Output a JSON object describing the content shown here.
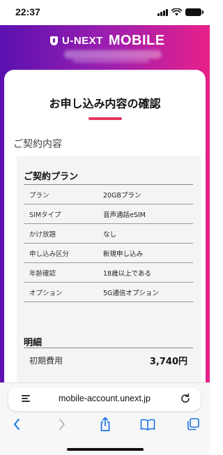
{
  "status_bar": {
    "time": "22:37"
  },
  "header": {
    "brand_name": "U-NEXT",
    "brand_product": "MOBILE"
  },
  "page": {
    "title": "お申し込み内容の確認",
    "section_title": "ご契約内容"
  },
  "plan": {
    "title": "ご契約プラン",
    "rows": [
      {
        "key": "プラン",
        "value": "20GBプラン"
      },
      {
        "key": "SIMタイプ",
        "value": "音声通話eSIM"
      },
      {
        "key": "かけ放題",
        "value": "なし"
      },
      {
        "key": "申し込み区分",
        "value": "新規申し込み"
      },
      {
        "key": "年齢確認",
        "value": "18歳以上である"
      },
      {
        "key": "オプション",
        "value": "5G通信オプション"
      }
    ]
  },
  "details": {
    "title": "明細",
    "initial_fee_label": "初期費用",
    "initial_fee_value": "3,740円"
  },
  "browser": {
    "url": "mobile-account.unext.jp",
    "accent_color": "#1a73e8",
    "icons": [
      "back-icon",
      "forward-icon",
      "share-icon",
      "bookmarks-icon",
      "tabs-icon"
    ]
  },
  "colors": {
    "brand_gradient_start": "#5a10b0",
    "brand_gradient_end": "#e8208a",
    "title_underline": "#e8365f"
  }
}
